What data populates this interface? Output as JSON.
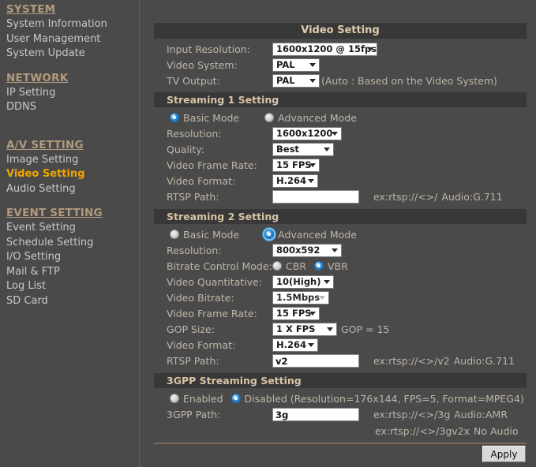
{
  "colors": {
    "page_bg": "#4a4a4a",
    "panel_bar": "#383838",
    "accent_active": "#f0a500",
    "heading": "#b39a7d",
    "label": "#c0b6a8",
    "radio_on": "#2f8fe0"
  },
  "sidebar": {
    "groups": [
      {
        "heading": "SYSTEM",
        "items": [
          {
            "label": "System Information",
            "active": false
          },
          {
            "label": "User Management",
            "active": false
          },
          {
            "label": "System Update",
            "active": false
          }
        ]
      },
      {
        "heading": "NETWORK",
        "items": [
          {
            "label": "IP Setting",
            "active": false
          },
          {
            "label": "DDNS",
            "active": false
          }
        ]
      },
      {
        "heading": "A/V SETTING",
        "items": [
          {
            "label": "Image Setting",
            "active": false
          },
          {
            "label": "Video Setting",
            "active": true
          },
          {
            "label": "Audio Setting",
            "active": false
          }
        ]
      },
      {
        "heading": "EVENT SETTING",
        "items": [
          {
            "label": "Event Setting",
            "active": false
          },
          {
            "label": "Schedule Setting",
            "active": false
          },
          {
            "label": "I/O Setting",
            "active": false
          },
          {
            "label": "Mail & FTP",
            "active": false
          },
          {
            "label": "Log List",
            "active": false
          },
          {
            "label": "SD Card",
            "active": false
          }
        ]
      }
    ]
  },
  "panel": {
    "title": "Video Setting",
    "top": {
      "input_resolution_label": "Input Resolution:",
      "input_resolution_value": "1600x1200 @ 15fps",
      "video_system_label": "Video System:",
      "video_system_value": "PAL",
      "tv_output_label": "TV Output:",
      "tv_output_value": "PAL",
      "tv_output_note": "(Auto : Based on the Video System)"
    },
    "streaming1": {
      "section_title": "Streaming 1 Setting",
      "mode_basic_label": "Basic Mode",
      "mode_advanced_label": "Advanced Mode",
      "mode_selected": "basic",
      "resolution_label": "Resolution:",
      "resolution_value": "1600x1200",
      "quality_label": "Quality:",
      "quality_value": "Best",
      "frame_rate_label": "Video Frame Rate:",
      "frame_rate_value": "15 FPS",
      "video_format_label": "Video Format:",
      "video_format_value": "H.264",
      "rtsp_path_label": "RTSP Path:",
      "rtsp_path_value": "",
      "rtsp_example": "ex:rtsp://<>/",
      "audio_note": "Audio:G.711"
    },
    "streaming2": {
      "section_title": "Streaming 2 Setting",
      "mode_basic_label": "Basic Mode",
      "mode_advanced_label": "Advanced Mode",
      "mode_selected": "advanced",
      "resolution_label": "Resolution:",
      "resolution_value": "800x592",
      "bitrate_control_label": "Bitrate Control Mode:",
      "cbr_label": "CBR",
      "vbr_label": "VBR",
      "bitrate_control_selected": "VBR",
      "quantitative_label": "Video Quantitative:",
      "quantitative_value": "10(High)",
      "bitrate_label": "Video Bitrate:",
      "bitrate_value": "1.5Mbps",
      "frame_rate_label": "Video Frame Rate:",
      "frame_rate_value": "15 FPS",
      "gop_size_label": "GOP Size:",
      "gop_size_value": "1 X FPS",
      "gop_note": "GOP = 15",
      "video_format_label": "Video Format:",
      "video_format_value": "H.264",
      "rtsp_path_label": "RTSP Path:",
      "rtsp_path_value": "v2",
      "rtsp_example": "ex:rtsp://<>/v2",
      "audio_note": "Audio:G.711"
    },
    "streaming3gpp": {
      "section_title": "3GPP Streaming Setting",
      "enabled_label": "Enabled",
      "disabled_label": "Disabled (Resolution=176x144, FPS=5, Format=MPEG4)",
      "selected": "disabled",
      "path_label": "3GPP Path:",
      "path_value": "3g",
      "path_example": "ex:rtsp://<>/3g",
      "path_audio": "Audio:AMR",
      "path_example2": "ex:rtsp://<>/3gv2x",
      "path_audio2": "No Audio"
    },
    "apply_label": "Apply"
  }
}
